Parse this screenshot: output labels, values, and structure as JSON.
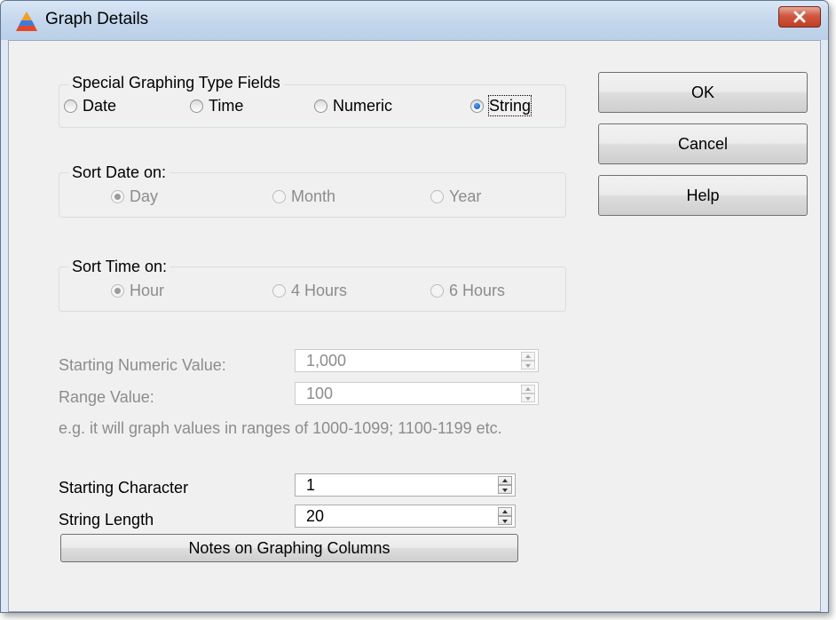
{
  "window": {
    "title": "Graph Details",
    "app_icon": "pyramid-icon",
    "close_icon": "close-icon"
  },
  "type_group": {
    "caption": "Special Graphing Type Fields",
    "options": [
      {
        "label": "Date",
        "checked": false
      },
      {
        "label": "Time",
        "checked": false
      },
      {
        "label": "Numeric",
        "checked": false
      },
      {
        "label": "String",
        "checked": true
      }
    ]
  },
  "sort_date": {
    "caption": "Sort Date on:",
    "options": [
      {
        "label": "Day",
        "checked": true
      },
      {
        "label": "Month",
        "checked": false
      },
      {
        "label": "Year",
        "checked": false
      }
    ]
  },
  "sort_time": {
    "caption": "Sort Time on:",
    "options": [
      {
        "label": "Hour",
        "checked": true
      },
      {
        "label": "4 Hours",
        "checked": false
      },
      {
        "label": "6 Hours",
        "checked": false
      }
    ]
  },
  "numeric": {
    "start_label": "Starting Numeric Value:",
    "start_value": "1,000",
    "range_label": "Range Value:",
    "range_value": "100",
    "hint": "e.g. it will graph values in ranges of 1000-1099; 1100-1199 etc."
  },
  "string": {
    "start_label": "Starting Character",
    "start_value": "1",
    "length_label": "String Length",
    "length_value": "20"
  },
  "buttons": {
    "ok": "OK",
    "cancel": "Cancel",
    "help": "Help",
    "notes": "Notes on Graphing Columns"
  }
}
